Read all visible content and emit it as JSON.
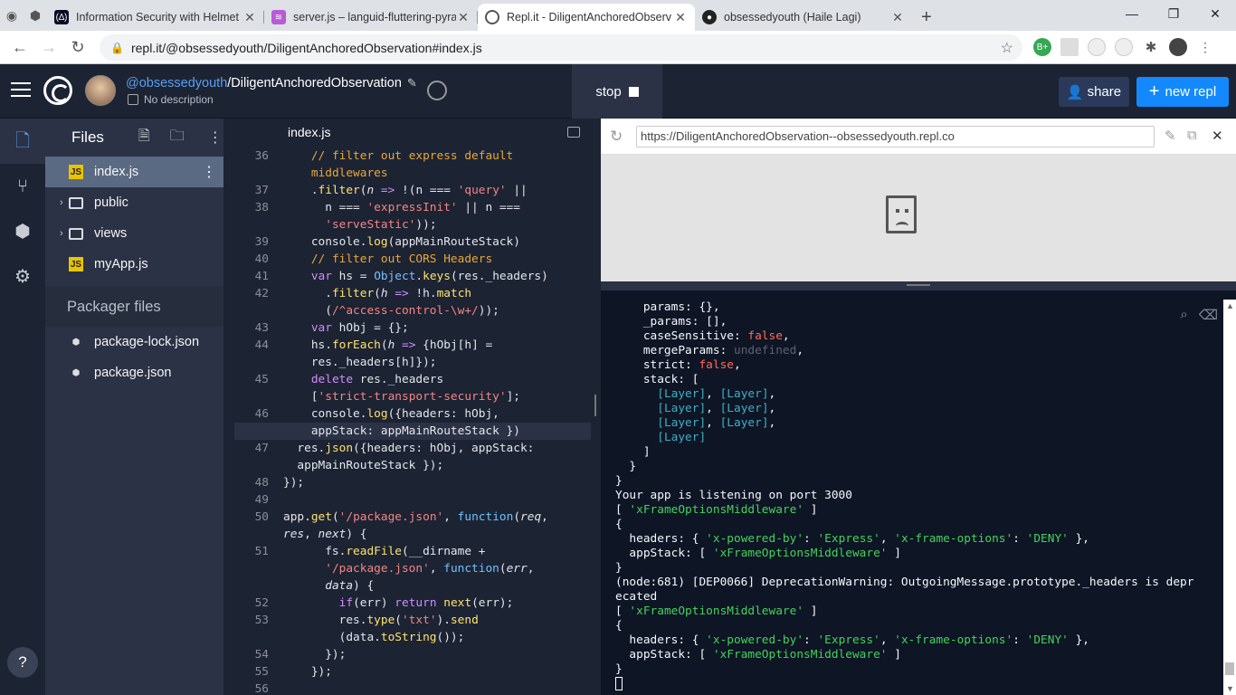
{
  "browser": {
    "tabs": [
      {
        "title": "Information Security with Helmet",
        "favicon": "fcc-icon",
        "active": false
      },
      {
        "title": "server.js – languid-fluttering-pyra",
        "favicon": "glitch-icon",
        "active": false
      },
      {
        "title": "Repl.it - DiligentAnchoredObserv",
        "favicon": "replit-icon",
        "active": true
      },
      {
        "title": "obsessedyouth (Haile Lagi)",
        "favicon": "github-icon",
        "active": false
      }
    ],
    "url": "repl.it/@obsessedyouth/DiligentAnchoredObservation#index.js"
  },
  "header": {
    "user": "@obsessedyouth",
    "repl_name": "/DiligentAnchoredObservation",
    "description": "No description",
    "stop_label": "stop",
    "share_label": "share",
    "new_repl_label": "new repl"
  },
  "files": {
    "title": "Files",
    "items": [
      {
        "name": "index.js",
        "type": "js"
      },
      {
        "name": "public",
        "type": "folder"
      },
      {
        "name": "views",
        "type": "folder"
      },
      {
        "name": "myApp.js",
        "type": "js"
      }
    ],
    "packager_title": "Packager files",
    "packager_items": [
      "package-lock.json",
      "package.json"
    ]
  },
  "editor": {
    "tab": "index.js"
  },
  "webview": {
    "url": "https://DiligentAnchoredObservation--obsessedyouth.repl.co"
  },
  "console": {
    "listening": "Your app is listening on port 3000",
    "warning1": "(node:681) [DEP0066] DeprecationWarning: OutgoingMessage.prototype._headers is depr",
    "warning2": "ecated"
  },
  "help_label": "?"
}
